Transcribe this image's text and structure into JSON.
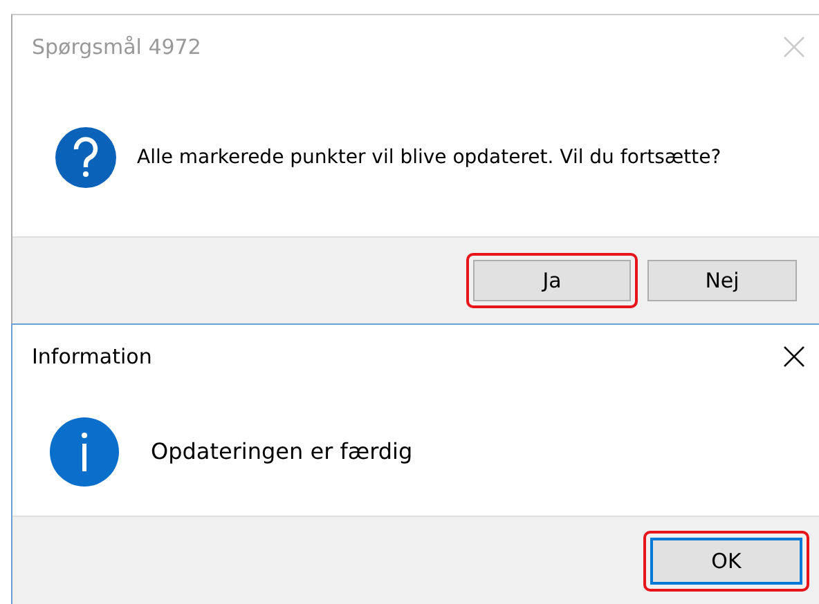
{
  "dialogs": [
    {
      "title": "Spørgsmål 4972",
      "active": false,
      "kind": "question",
      "message": "Alle markerede punkter vil blive opdateret. Vil du fortsætte?",
      "buttons": [
        {
          "label": "Ja",
          "highlighted": true,
          "focused": false
        },
        {
          "label": "Nej",
          "highlighted": false,
          "focused": false
        }
      ]
    },
    {
      "title": "Information",
      "active": true,
      "kind": "info",
      "message": "Opdateringen er færdig",
      "buttons": [
        {
          "label": "OK",
          "highlighted": true,
          "focused": true
        }
      ]
    }
  ]
}
